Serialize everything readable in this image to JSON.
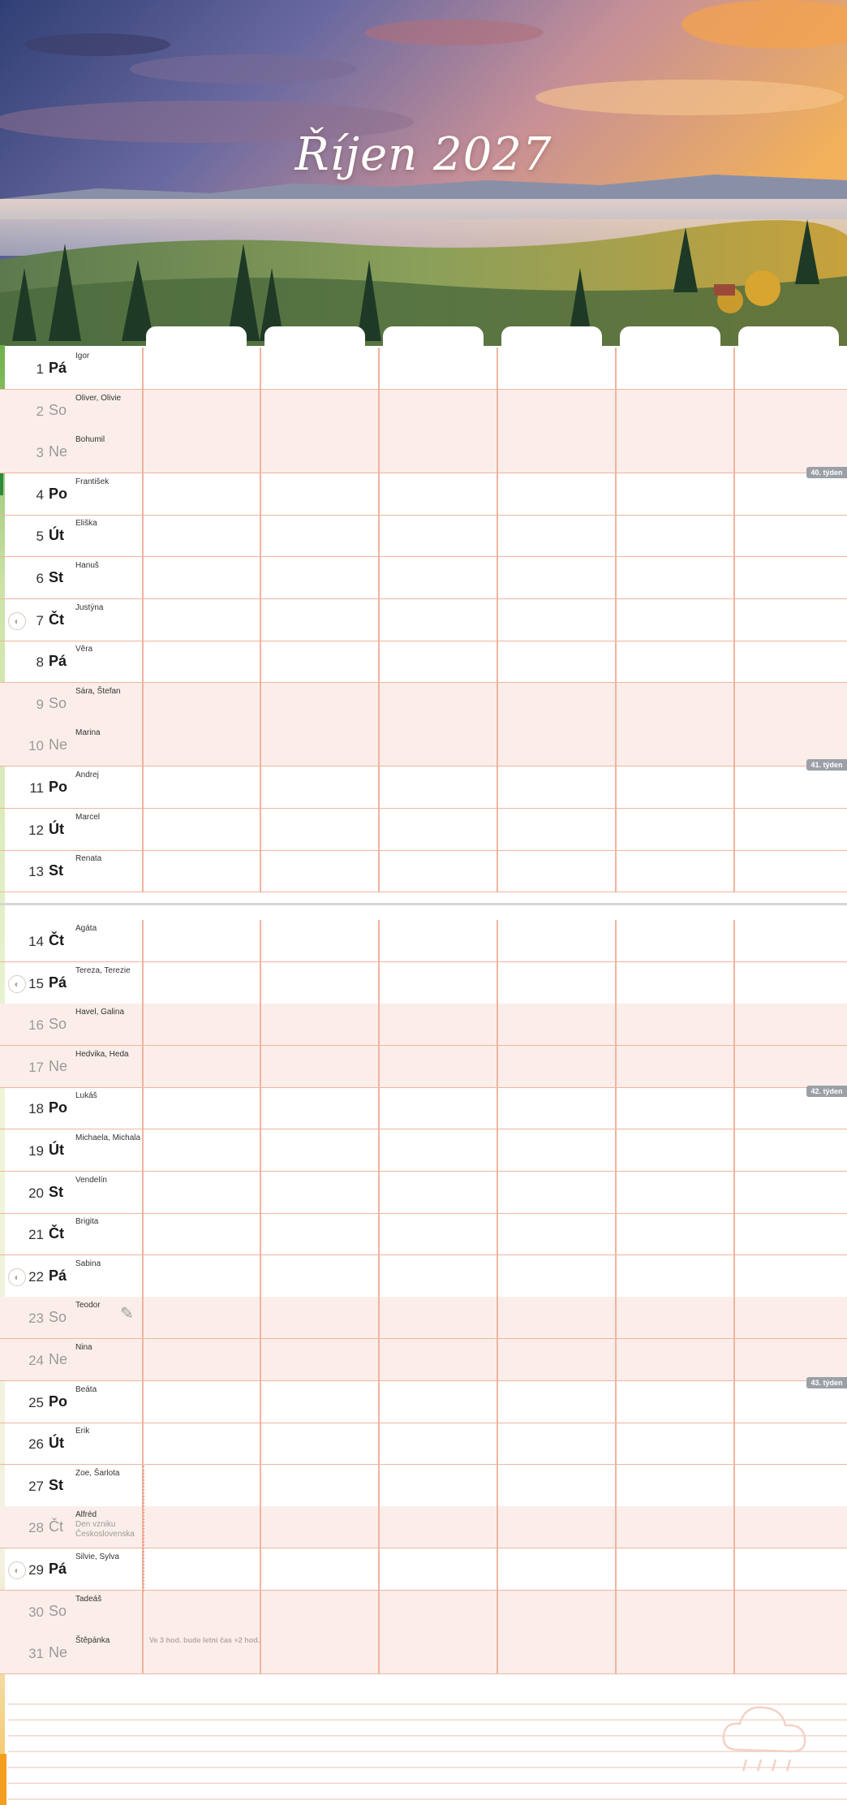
{
  "page": {
    "title": "Říjen 2027"
  },
  "days": [
    {
      "day": "1",
      "dow": "Pá",
      "names": "Igor",
      "weekend": false
    },
    {
      "day": "2",
      "dow": "So",
      "names": "Oliver, Olivie",
      "weekend": true
    },
    {
      "day": "3",
      "dow": "Ne",
      "names": "Bohumil",
      "weekend": true
    },
    {
      "day": "4",
      "dow": "Po",
      "names": "František",
      "weekend": false
    },
    {
      "day": "5",
      "dow": "Út",
      "names": "Eliška",
      "weekend": false
    },
    {
      "day": "6",
      "dow": "St",
      "names": "Hanuš",
      "weekend": false
    },
    {
      "day": "7",
      "dow": "Čt",
      "names": "Justýna",
      "weekend": false
    },
    {
      "day": "8",
      "dow": "Pá",
      "names": "Věra",
      "weekend": false
    },
    {
      "day": "9",
      "dow": "So",
      "names": "Sára, Štefan",
      "weekend": true
    },
    {
      "day": "10",
      "dow": "Ne",
      "names": "Marina",
      "weekend": true
    },
    {
      "day": "11",
      "dow": "Po",
      "names": "Andrej",
      "weekend": false
    },
    {
      "day": "12",
      "dow": "Út",
      "names": "Marcel",
      "weekend": false
    },
    {
      "day": "13",
      "dow": "St",
      "names": "Renata",
      "weekend": false
    },
    {
      "day": "14",
      "dow": "Čt",
      "names": "Agáta",
      "weekend": false
    },
    {
      "day": "15",
      "dow": "Pá",
      "names": "Tereza, Terezie",
      "weekend": false
    },
    {
      "day": "16",
      "dow": "So",
      "names": "Havel, Galina",
      "weekend": true
    },
    {
      "day": "17",
      "dow": "Ne",
      "names": "Hedvika, Heda",
      "weekend": true
    },
    {
      "day": "18",
      "dow": "Po",
      "names": "Lukáš",
      "weekend": false
    },
    {
      "day": "19",
      "dow": "Út",
      "names": "Michaela, Michala",
      "weekend": false
    },
    {
      "day": "20",
      "dow": "St",
      "names": "Vendelín",
      "weekend": false
    },
    {
      "day": "21",
      "dow": "Čt",
      "names": "Brigita",
      "weekend": false
    },
    {
      "day": "22",
      "dow": "Pá",
      "names": "Sabina",
      "weekend": false
    },
    {
      "day": "23",
      "dow": "So",
      "names": "Teodor",
      "weekend": true
    },
    {
      "day": "24",
      "dow": "Ne",
      "names": "Nina",
      "weekend": true
    },
    {
      "day": "25",
      "dow": "Po",
      "names": "Beáta",
      "weekend": false
    },
    {
      "day": "26",
      "dow": "Út",
      "names": "Erik",
      "weekend": false
    },
    {
      "day": "27",
      "dow": "St",
      "names": "Zoe, Šarlota",
      "weekend": false
    },
    {
      "day": "28",
      "dow": "Čt",
      "names": "Alfréd",
      "holiday": "Den vzniku Československa",
      "weekend": true
    },
    {
      "day": "29",
      "dow": "Pá",
      "names": "Silvie, Sylva",
      "weekend": false
    },
    {
      "day": "30",
      "dow": "So",
      "names": "Tadeáš",
      "weekend": true
    },
    {
      "day": "31",
      "dow": "Ne",
      "names": "Štěpánka",
      "weekend": true
    }
  ],
  "weeks": [
    "40. týden",
    "41. týden",
    "42. týden",
    "43. týden"
  ],
  "note": "Ve 3 hod. bude letní čas +2 hod.",
  "colors": {
    "grid": "#f0b49e",
    "weekend_bg": "#fbeeea",
    "week_badge": "#9aa0a6"
  }
}
